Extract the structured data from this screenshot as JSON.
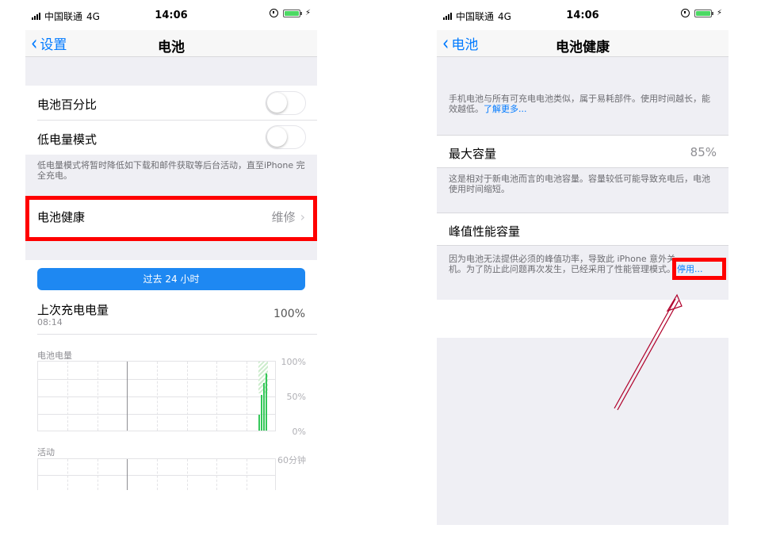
{
  "left": {
    "status": {
      "carrier": "中国联通",
      "network": "4G",
      "time": "14:06"
    },
    "nav": {
      "back_label": "设置",
      "title": "电池"
    },
    "battery_percentage": {
      "label": "电池百分比",
      "on": false
    },
    "low_power_mode": {
      "label": "低电量模式",
      "on": false
    },
    "low_power_note": "低电量模式将暂时降低如下载和邮件获取等后台活动，直至iPhone 完全充电。",
    "battery_health": {
      "label": "电池健康",
      "value": "维修"
    },
    "segment": "过去 24 小时",
    "last_charge": {
      "title": "上次充电电量",
      "time": "08:14",
      "value": "100%"
    },
    "battery_chart": {
      "title": "电池电量",
      "labels": [
        "100%",
        "50%",
        "0%"
      ]
    },
    "activity_chart": {
      "title": "活动",
      "labels": [
        "60分钟"
      ]
    }
  },
  "right": {
    "status": {
      "carrier": "中国联通",
      "network": "4G",
      "time": "14:06"
    },
    "nav": {
      "back_label": "电池",
      "title": "电池健康"
    },
    "intro": "手机电池与所有可充电电池类似，属于易耗部件。使用时间越长，能效越低。",
    "learn_more": "了解更多...",
    "max_capacity": {
      "label": "最大容量",
      "value": "85%"
    },
    "capacity_note": "这是相对于新电池而言的电池容量。容量较低可能导致充电后，电池使用时间缩短。",
    "peak": {
      "label": "峰值性能容量"
    },
    "peak_note": "因为电池无法提供必须的峰值功率，导致此 iPhone 意外关机。为了防止此问题再次发生，已经采用了性能管理模式。",
    "disable_link": "停用..."
  },
  "colors": {
    "accent": "#007aff",
    "highlight": "#ff0000",
    "segment": "#1e88f2",
    "chart": "#34c759"
  }
}
